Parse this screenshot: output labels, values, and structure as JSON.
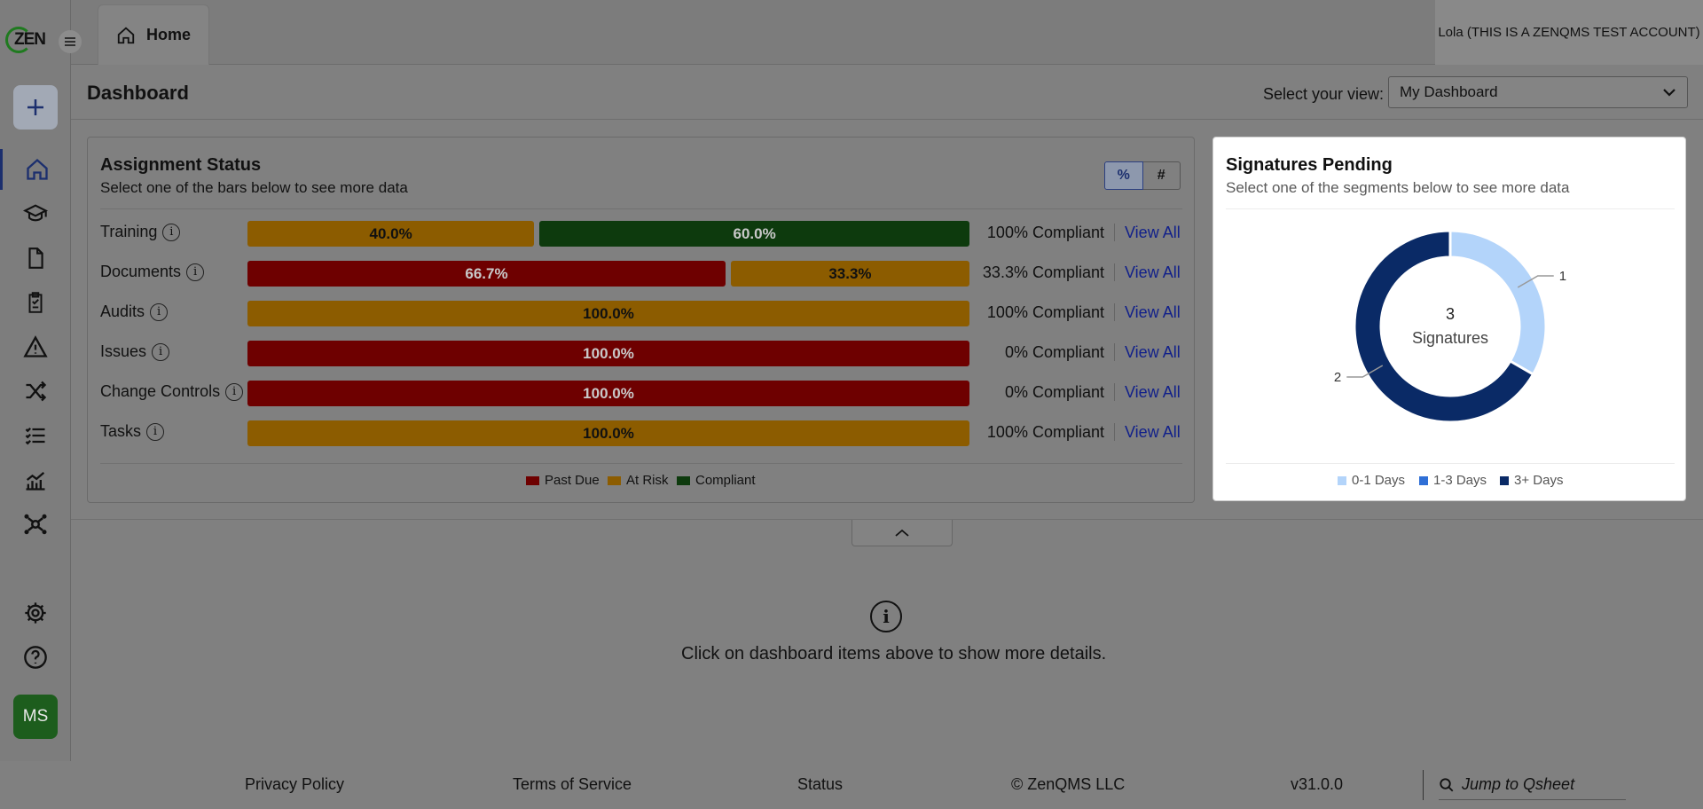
{
  "app": {
    "logo_text": "ZEN",
    "tab_home_label": "Home",
    "account_label": "Lola (THIS IS A ZENQMS TEST ACCOUNT)"
  },
  "sidebar": {
    "items": [
      {
        "name": "home",
        "icon": "home-icon",
        "active": true
      },
      {
        "name": "training",
        "icon": "graduation-cap-icon"
      },
      {
        "name": "documents",
        "icon": "document-icon"
      },
      {
        "name": "audits",
        "icon": "clipboard-icon"
      },
      {
        "name": "issues",
        "icon": "warning-icon"
      },
      {
        "name": "change-controls",
        "icon": "shuffle-icon"
      },
      {
        "name": "tasks",
        "icon": "checklist-icon"
      },
      {
        "name": "reports",
        "icon": "chart-icon"
      },
      {
        "name": "network",
        "icon": "network-icon"
      },
      {
        "name": "settings",
        "icon": "gear-icon"
      },
      {
        "name": "help",
        "icon": "help-icon"
      }
    ],
    "user_initials": "MS"
  },
  "header": {
    "title": "Dashboard",
    "view_label": "Select your view:",
    "view_value": "My Dashboard"
  },
  "assignment": {
    "title": "Assignment Status",
    "subtitle": "Select one of the bars below to see more data",
    "toggle_pct": "%",
    "toggle_num": "#",
    "view_all": "View All",
    "rows": [
      {
        "label": "Training",
        "compliance": "100% Compliant",
        "segments": [
          {
            "status": "at_risk",
            "pct": 40.0,
            "label": "40.0%"
          },
          {
            "status": "compliant",
            "pct": 60.0,
            "label": "60.0%"
          }
        ]
      },
      {
        "label": "Documents",
        "compliance": "33.3% Compliant",
        "segments": [
          {
            "status": "past_due",
            "pct": 66.7,
            "label": "66.7%"
          },
          {
            "status": "at_risk",
            "pct": 33.3,
            "label": "33.3%"
          }
        ]
      },
      {
        "label": "Audits",
        "compliance": "100% Compliant",
        "segments": [
          {
            "status": "at_risk",
            "pct": 100.0,
            "label": "100.0%"
          }
        ]
      },
      {
        "label": "Issues",
        "compliance": "0% Compliant",
        "segments": [
          {
            "status": "past_due",
            "pct": 100.0,
            "label": "100.0%"
          }
        ]
      },
      {
        "label": "Change Controls",
        "compliance": "0% Compliant",
        "segments": [
          {
            "status": "past_due",
            "pct": 100.0,
            "label": "100.0%"
          }
        ]
      },
      {
        "label": "Tasks",
        "compliance": "100% Compliant",
        "segments": [
          {
            "status": "at_risk",
            "pct": 100.0,
            "label": "100.0%"
          }
        ]
      }
    ],
    "legend": [
      {
        "key": "past_due",
        "label": "Past Due"
      },
      {
        "key": "at_risk",
        "label": "At Risk"
      },
      {
        "key": "compliant",
        "label": "Compliant"
      }
    ],
    "colors": {
      "past_due": "#6e0000",
      "at_risk": "#8c5c00",
      "compliant": "#0d3a0d"
    }
  },
  "signatures": {
    "title": "Signatures Pending",
    "subtitle": "Select one of the segments below to see more data",
    "center_count": "3",
    "center_label": "Signatures",
    "legend": [
      {
        "label": "0-1 Days",
        "color": "#b3d4fa"
      },
      {
        "label": "1-3 Days",
        "color": "#2f6fd6"
      },
      {
        "label": "3+ Days",
        "color": "#0a2a66"
      }
    ]
  },
  "chart_data": {
    "type": "pie",
    "categories": [
      "0-1 Days",
      "1-3 Days",
      "3+ Days"
    ],
    "values": [
      1,
      0,
      2
    ],
    "data_labels": [
      "1",
      "",
      "2"
    ],
    "center_text": "3 Signatures",
    "legend_position": "bottom"
  },
  "details": {
    "message": "Click on dashboard items above to show more details."
  },
  "footer": {
    "privacy": "Privacy Policy",
    "terms": "Terms of Service",
    "status": "Status",
    "copyright": "© ZenQMS LLC",
    "version": "v31.0.0",
    "search_placeholder": "Jump to Qsheet"
  }
}
